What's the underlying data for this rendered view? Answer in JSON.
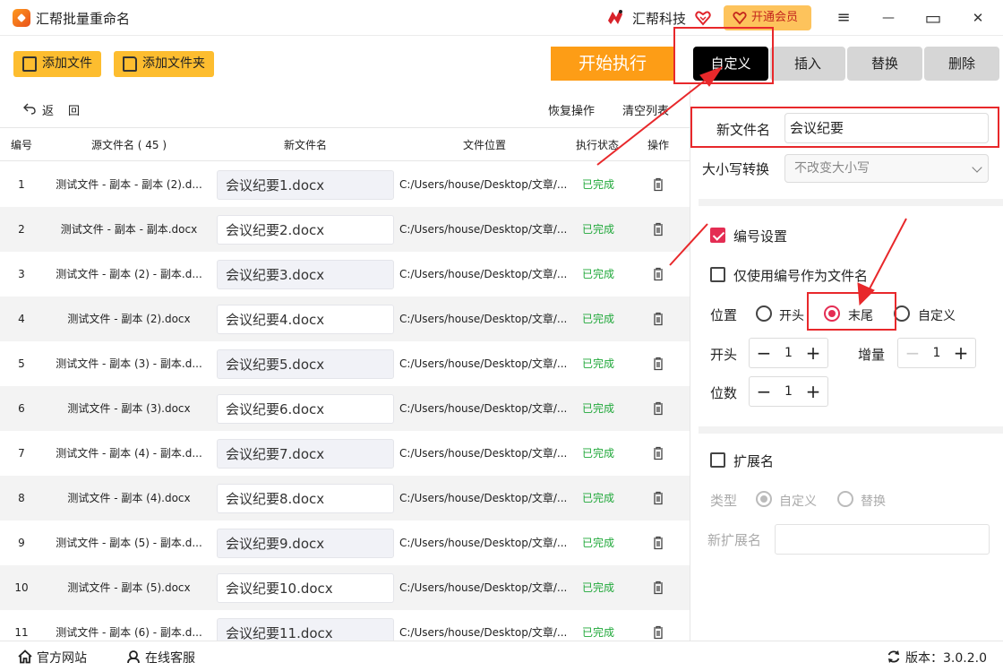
{
  "app": {
    "title": "汇帮批量重命名",
    "brand": "汇帮科技",
    "vip_label": "开通会员"
  },
  "window": {
    "menu": "≡",
    "minimize": "—",
    "maximize": "▭",
    "close": "✕"
  },
  "toolbar": {
    "add_file": "添加文件",
    "add_folder": "添加文件夹",
    "start": "开始执行",
    "tabs": [
      "自定义",
      "插入",
      "替换",
      "删除"
    ],
    "active_tab": 0
  },
  "subheader": {
    "back": "返",
    "back2": "回",
    "restore": "恢复操作",
    "clear": "清空列表"
  },
  "table": {
    "headers": [
      "编号",
      "源文件名 ( 45 )",
      "新文件名",
      "文件位置",
      "执行状态",
      "操作"
    ],
    "rows": [
      {
        "idx": "1",
        "src": "测试文件 - 副本 - 副本 (2).d...",
        "new": "会议纪要1.docx",
        "path": "C:/Users/house/Desktop/文章/...",
        "status": "已完成"
      },
      {
        "idx": "2",
        "src": "测试文件 - 副本 - 副本.docx",
        "new": "会议纪要2.docx",
        "path": "C:/Users/house/Desktop/文章/...",
        "status": "已完成"
      },
      {
        "idx": "3",
        "src": "测试文件 - 副本 (2) - 副本.d...",
        "new": "会议纪要3.docx",
        "path": "C:/Users/house/Desktop/文章/...",
        "status": "已完成"
      },
      {
        "idx": "4",
        "src": "测试文件 - 副本 (2).docx",
        "new": "会议纪要4.docx",
        "path": "C:/Users/house/Desktop/文章/...",
        "status": "已完成"
      },
      {
        "idx": "5",
        "src": "测试文件 - 副本 (3) - 副本.d...",
        "new": "会议纪要5.docx",
        "path": "C:/Users/house/Desktop/文章/...",
        "status": "已完成"
      },
      {
        "idx": "6",
        "src": "测试文件 - 副本 (3).docx",
        "new": "会议纪要6.docx",
        "path": "C:/Users/house/Desktop/文章/...",
        "status": "已完成"
      },
      {
        "idx": "7",
        "src": "测试文件 - 副本 (4) - 副本.d...",
        "new": "会议纪要7.docx",
        "path": "C:/Users/house/Desktop/文章/...",
        "status": "已完成"
      },
      {
        "idx": "8",
        "src": "测试文件 - 副本 (4).docx",
        "new": "会议纪要8.docx",
        "path": "C:/Users/house/Desktop/文章/...",
        "status": "已完成"
      },
      {
        "idx": "9",
        "src": "测试文件 - 副本 (5) - 副本.d...",
        "new": "会议纪要9.docx",
        "path": "C:/Users/house/Desktop/文章/...",
        "status": "已完成"
      },
      {
        "idx": "10",
        "src": "测试文件 - 副本 (5).docx",
        "new": "会议纪要10.docx",
        "path": "C:/Users/house/Desktop/文章/...",
        "status": "已完成"
      },
      {
        "idx": "11",
        "src": "测试文件 - 副本 (6) - 副本.d...",
        "new": "会议纪要11.docx",
        "path": "C:/Users/house/Desktop/文章/...",
        "status": "已完成"
      }
    ]
  },
  "panel": {
    "new_name_label": "新文件名",
    "new_name_value": "会议纪要",
    "case_label": "大小写转换",
    "case_value": "不改变大小写",
    "numbering_label": "编号设置",
    "only_number_label": "仅使用编号作为文件名",
    "position_label": "位置",
    "position_options": [
      "开头",
      "末尾",
      "自定义"
    ],
    "position_selected": "末尾",
    "start_label": "开头",
    "start_value": "1",
    "increment_label": "增量",
    "increment_value": "1",
    "digits_label": "位数",
    "digits_value": "1",
    "extension_label": "扩展名",
    "type_label": "类型",
    "type_options": [
      "自定义",
      "替换"
    ],
    "new_ext_label": "新扩展名"
  },
  "footer": {
    "website": "官方网站",
    "support": "在线客服",
    "version": "版本：3.0.2.0"
  },
  "colors": {
    "accent_orange": "#fd9d16",
    "toolbar_yellow": "#fdbd2f",
    "status_green": "#20a83a",
    "check_red": "#e42d53",
    "annotation_red": "#e8282b"
  }
}
